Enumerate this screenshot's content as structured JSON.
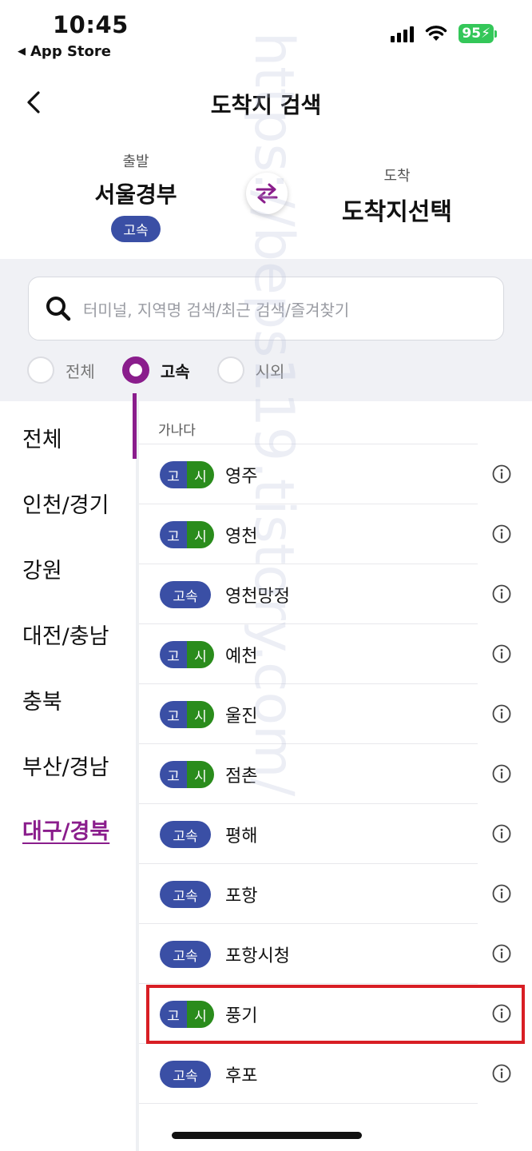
{
  "status_bar": {
    "time": "10:45",
    "back_app_label": "App Store",
    "battery": "95"
  },
  "header": {
    "title": "도착지 검색"
  },
  "route": {
    "departure_label": "출발",
    "departure_name": "서울경부",
    "departure_badge": "고속",
    "arrival_label": "도착",
    "arrival_name": "도착지선택"
  },
  "search": {
    "placeholder": "터미널, 지역명 검색/최근 검색/즐겨찾기"
  },
  "filters": [
    {
      "label": "전체",
      "selected": false
    },
    {
      "label": "고속",
      "selected": true
    },
    {
      "label": "시외",
      "selected": false
    }
  ],
  "regions": [
    {
      "label": "전체",
      "active": false
    },
    {
      "label": "인천/경기",
      "active": false
    },
    {
      "label": "강원",
      "active": false
    },
    {
      "label": "대전/충남",
      "active": false
    },
    {
      "label": "충북",
      "active": false
    },
    {
      "label": "부산/경남",
      "active": false
    },
    {
      "label": "대구/경북",
      "active": true
    }
  ],
  "list": {
    "section_header": "가나다",
    "terminals": [
      {
        "tag": "both",
        "tag_express": "고",
        "tag_intercity": "시",
        "name": "영주"
      },
      {
        "tag": "both",
        "tag_express": "고",
        "tag_intercity": "시",
        "name": "영천"
      },
      {
        "tag": "express",
        "tag_label": "고속",
        "name": "영천망정"
      },
      {
        "tag": "both",
        "tag_express": "고",
        "tag_intercity": "시",
        "name": "예천"
      },
      {
        "tag": "both",
        "tag_express": "고",
        "tag_intercity": "시",
        "name": "울진"
      },
      {
        "tag": "both",
        "tag_express": "고",
        "tag_intercity": "시",
        "name": "점촌"
      },
      {
        "tag": "express",
        "tag_label": "고속",
        "name": "평해"
      },
      {
        "tag": "express",
        "tag_label": "고속",
        "name": "포항"
      },
      {
        "tag": "express",
        "tag_label": "고속",
        "name": "포항시청"
      },
      {
        "tag": "both",
        "tag_express": "고",
        "tag_intercity": "시",
        "name": "풍기"
      },
      {
        "tag": "express",
        "tag_label": "고속",
        "name": "후포"
      }
    ]
  },
  "colors": {
    "accent": "#8a1d8c",
    "express_tag": "#3a4fa5",
    "intercity_tag": "#2a8c1c",
    "highlight_box": "#d81e24"
  },
  "watermark": "https://beps119.tistory.com/"
}
